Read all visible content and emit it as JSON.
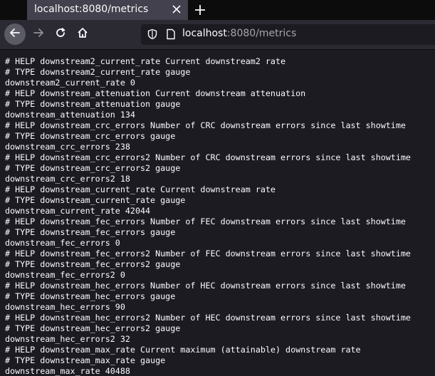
{
  "tab": {
    "title": "localhost:8080/metrics"
  },
  "urlbar": {
    "host": "localhost",
    "rest": ":8080/metrics"
  },
  "colors": {
    "tab_strip": "#0c0c0d",
    "active_tab": "#42414d",
    "toolbar": "#2b2a33",
    "page_background": "#1c1b22",
    "text": "#fbfbfe"
  },
  "icons": {
    "tab_close": "close-icon",
    "new_tab": "plus-icon",
    "back": "arrow-left-icon",
    "forward": "arrow-right-icon",
    "reload": "reload-icon",
    "home": "home-icon",
    "tracking_protection": "shield-icon",
    "page_info": "page-icon"
  },
  "content": {
    "lines": [
      "# HELP downstream2_current_rate Current downstream2 rate",
      "# TYPE downstream2_current_rate gauge",
      "downstream2_current_rate 0",
      "# HELP downstream_attenuation Current downstream attenuation",
      "# TYPE downstream_attenuation gauge",
      "downstream_attenuation 134",
      "# HELP downstream_crc_errors Number of CRC downstream errors since last showtime",
      "# TYPE downstream_crc_errors gauge",
      "downstream_crc_errors 238",
      "# HELP downstream_crc_errors2 Number of CRC downstream errors since last showtime",
      "# TYPE downstream_crc_errors2 gauge",
      "downstream_crc_errors2 18",
      "# HELP downstream_current_rate Current downstream rate",
      "# TYPE downstream_current_rate gauge",
      "downstream_current_rate 42044",
      "# HELP downstream_fec_errors Number of FEC downstream errors since last showtime",
      "# TYPE downstream_fec_errors gauge",
      "downstream_fec_errors 0",
      "# HELP downstream_fec_errors2 Number of FEC downstream errors since last showtime",
      "# TYPE downstream_fec_errors2 gauge",
      "downstream_fec_errors2 0",
      "# HELP downstream_hec_errors Number of HEC downstream errors since last showtime",
      "# TYPE downstream_hec_errors gauge",
      "downstream_hec_errors 90",
      "# HELP downstream_hec_errors2 Number of HEC downstream errors since last showtime",
      "# TYPE downstream_hec_errors2 gauge",
      "downstream_hec_errors2 32",
      "# HELP downstream_max_rate Current maximum (attainable) downstream rate",
      "# TYPE downstream_max_rate gauge",
      "downstream_max_rate 40488"
    ]
  }
}
